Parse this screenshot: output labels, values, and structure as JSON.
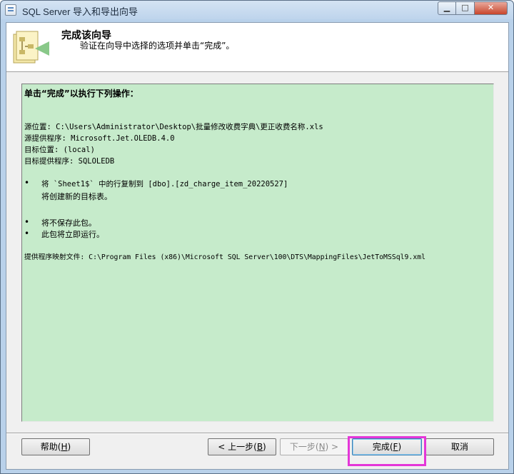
{
  "window": {
    "title": "SQL Server 导入和导出向导",
    "min_glyph": "▁",
    "max_glyph": "□",
    "close_glyph": "✕"
  },
  "header": {
    "title": "完成该向导",
    "subtitle": "验证在向导中选择的选项并单击“完成”。",
    "icon": "wizard-icon"
  },
  "summary": {
    "heading": "单击“完成”以执行下列操作：",
    "source_location": "源位置: C:\\Users\\Administrator\\Desktop\\批量修改收费字典\\更正收费名称.xls",
    "source_provider": "源提供程序: Microsoft.Jet.OLEDB.4.0",
    "dest_location": "目标位置: (local)",
    "dest_provider": "目标提供程序: SQLOLEDB",
    "bullet_glyph": "•",
    "copy_line": "将 `Sheet1$` 中的行复制到 [dbo].[zd_charge_item_20220527]",
    "create_line": "将创建新的目标表。",
    "no_save_line": "将不保存此包。",
    "run_now_line": "此包将立即运行。",
    "mapping_file": "提供程序映射文件: C:\\Program Files (x86)\\Microsoft SQL Server\\100\\DTS\\MappingFiles\\JetToMSSql9.xml"
  },
  "buttons": {
    "help": "帮助(",
    "help_key": "H",
    "back": "< 上一步(",
    "back_key": "B",
    "next": "下一步(",
    "next_key": "N",
    "next_suffix": ") >",
    "finish": "完成(",
    "finish_key": "F",
    "close_paren": ")",
    "cancel": "取消"
  },
  "colors": {
    "summary_bg": "#c6ebcb",
    "highlight": "#e436d8"
  }
}
